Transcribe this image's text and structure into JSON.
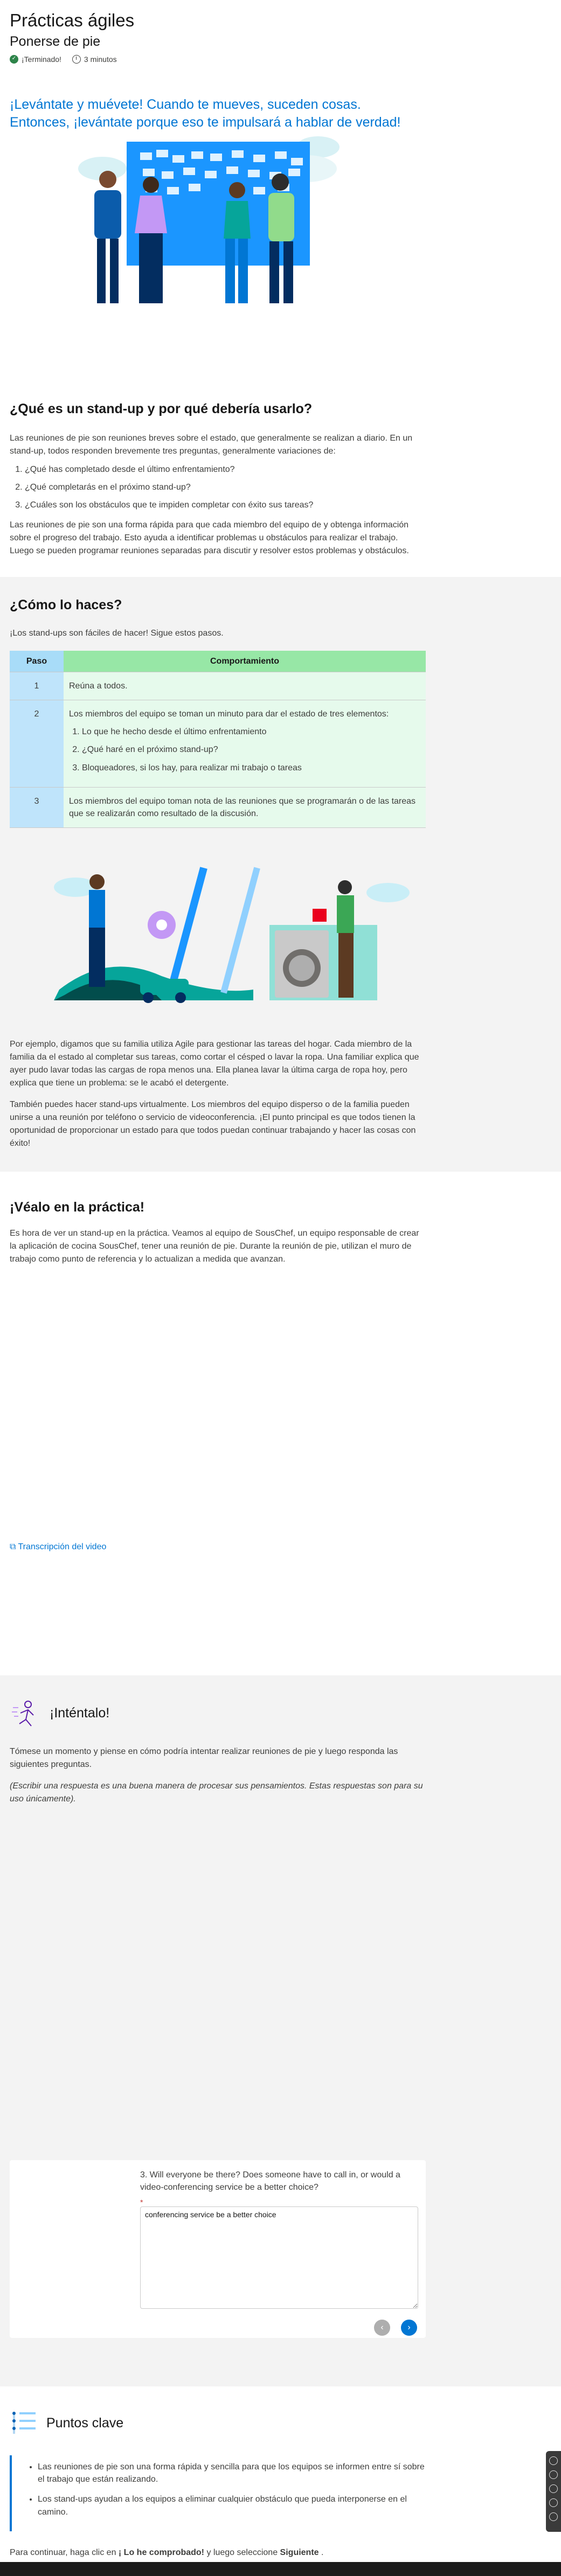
{
  "header": {
    "title": "Prácticas ágiles",
    "subtitle": "Ponerse de pie",
    "status": "¡Terminado!",
    "duration": "3 minutos"
  },
  "intro": "¡Levántate y muévete! Cuando te mueves, suceden cosas. Entonces, ¡levántate porque eso te impulsará a hablar de verdad!",
  "what": {
    "heading": "¿Qué es un stand-up y por qué debería usarlo?",
    "p1": "Las reuniones de pie son reuniones breves sobre el estado, que generalmente se realizan a diario. En un stand-up, todos responden brevemente tres preguntas, generalmente variaciones de:",
    "items": [
      "¿Qué has completado desde el último enfrentamiento?",
      "¿Qué completarás en el próximo stand-up?",
      "¿Cuáles son los obstáculos que te impiden completar con éxito sus tareas?"
    ],
    "p2": "Las reuniones de pie son una forma rápida para que cada miembro del equipo de y obtenga información sobre el progreso del trabajo. Esto ayuda a identificar problemas u obstáculos para realizar el trabajo. Luego se pueden programar reuniones separadas para discutir y resolver estos problemas y obstáculos."
  },
  "how": {
    "heading": "¿Cómo lo haces?",
    "p1": "¡Los stand-ups son fáciles de hacer! Sigue estos pasos.",
    "table": {
      "headers": [
        "Paso",
        "Comportamiento"
      ],
      "rows": [
        {
          "step": "1",
          "text": "Reúna a todos."
        },
        {
          "step": "2",
          "text": "Los miembros del equipo se toman un minuto para dar el estado de tres elementos:",
          "sub": [
            "Lo que he hecho desde el último enfrentamiento",
            "¿Qué haré en el próximo stand-up?",
            "Bloqueadores, si los hay, para realizar mi trabajo o tareas"
          ]
        },
        {
          "step": "3",
          "text": "Los miembros del equipo toman nota de las reuniones que se programarán o de las tareas que se realizarán como resultado de la discusión."
        }
      ]
    },
    "p2": "Por ejemplo, digamos que su familia utiliza Agile para gestionar las tareas del hogar. Cada miembro de la familia da el estado al completar sus tareas, como cortar el césped o lavar la ropa. Una familiar explica que ayer pudo lavar todas las cargas de ropa menos una. Ella planea lavar la última carga de ropa hoy, pero explica que tiene un problema: se le acabó el detergente.",
    "p3": "También puedes hacer stand-ups virtualmente. Los miembros del equipo disperso o de la familia pueden unirse a una reunión por teléfono o servicio de videoconferencia. ¡El punto principal es que todos tienen la oportunidad de proporcionar un estado para que todos puedan continuar trabajando y hacer las cosas con éxito!"
  },
  "practice": {
    "heading": "¡Véalo en la práctica!",
    "p1": "Es hora de ver un stand-up en la práctica. Veamos al equipo de SousChef, un equipo responsable de crear la aplicación de cocina SousChef, tener una reunión de pie. Durante la reunión de pie, utilizan el muro de trabajo como punto de referencia y lo actualizan a medida que avanzan.",
    "video_link": "Transcripción del video"
  },
  "try": {
    "heading": "¡Inténtalo!",
    "p1": "Tómese un momento y piense en cómo podría intentar realizar reuniones de pie y luego responda las siguientes preguntas.",
    "p2": "(Escribir una respuesta es una buena manera de procesar sus pensamientos. Estas respuestas son para su uso únicamente).",
    "question": "3. Will everyone be there? Does someone have to call in, or would a video-conferencing service be a better choice?",
    "required": "*",
    "answer": "conferencing service be a better choice"
  },
  "keypoints": {
    "heading": "Puntos clave",
    "items": [
      "Las reuniones de pie son una forma rápida y sencilla para que los equipos se informen entre sí sobre el trabajo que están realizando.",
      "Los stand-ups ayudan a los equipos a eliminar cualquier obstáculo que pueda interponerse en el camino."
    ]
  },
  "footer": {
    "pre": "Para continuar, haga clic en ",
    "b1": "¡ Lo he comprobado!",
    "mid": " y luego seleccione ",
    "b2": "Siguiente",
    "post": " ."
  }
}
